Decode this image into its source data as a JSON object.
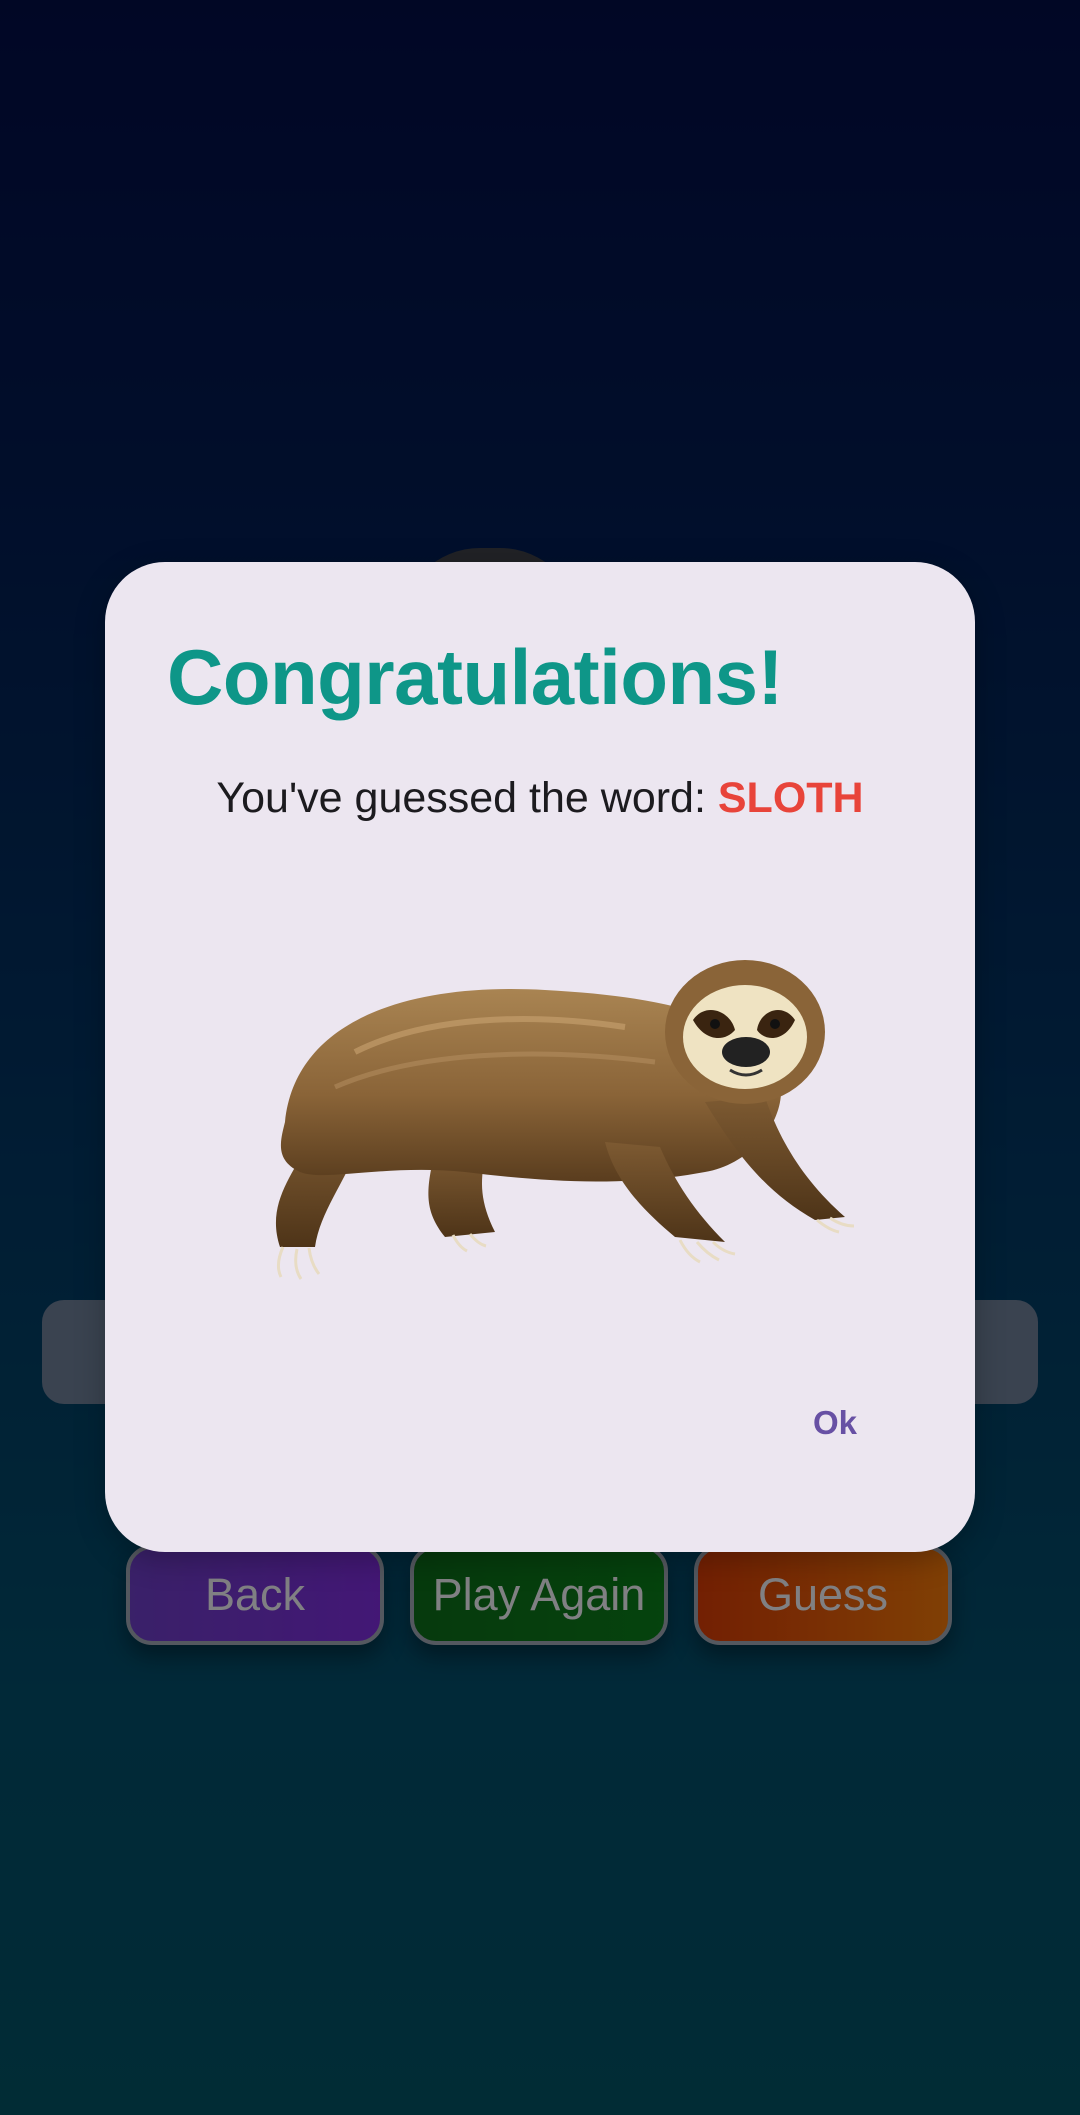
{
  "buttons": {
    "back_label": "Back",
    "play_again_label": "Play Again",
    "guess_label": "Guess"
  },
  "dialog": {
    "title": "Congratulations!",
    "message_prefix": "You've guessed the word: ",
    "word": "SLOTH",
    "ok_label": "Ok",
    "image_icon": "sloth-illustration"
  },
  "colors": {
    "title": "#0e9688",
    "word": "#e8443a",
    "ok": "#6750a4",
    "dialog_bg": "#ece6f0"
  }
}
